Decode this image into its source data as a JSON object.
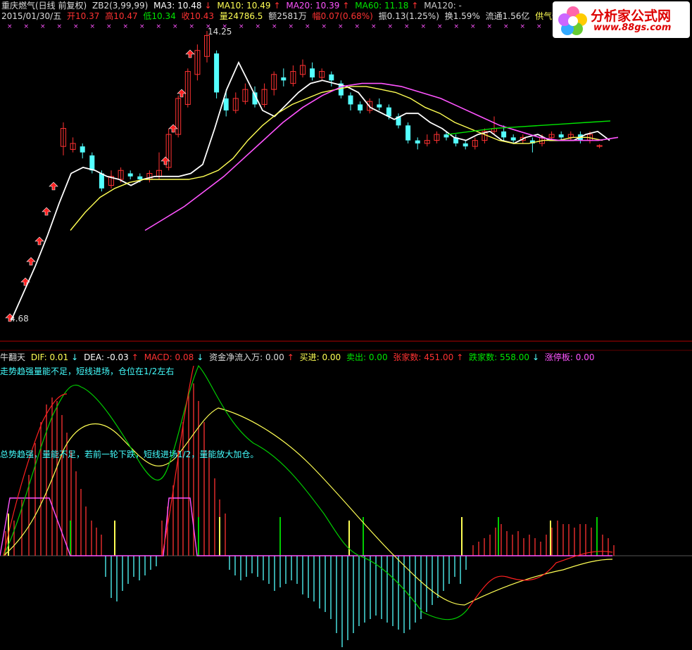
{
  "header": {
    "stock": "重庆燃气(日线 前复权)",
    "ind": "ZB2(3,99,99)",
    "ma3": "MA3: 10.48",
    "ma10": "MA10: 10.49",
    "ma20": "MA20: 10.39",
    "ma60": "MA60: 11.18",
    "ma120": "MA120: -",
    "date": "2015/01/30/五",
    "open": "开10.37",
    "high": "高10.47",
    "low": "低10.34",
    "close": "收10.43",
    "vol": "量24786.5",
    "amount": "额2581万",
    "pct": "幅0.07(0.68%)",
    "amp": "振0.13(1.25%)",
    "turn": "换1.59%",
    "float": "流通1.56亿",
    "tag": "供气供热",
    "high_label": "14.25",
    "low_label": "4.68"
  },
  "sub": {
    "name": "牛翻天",
    "dif": "DIF: 0.01",
    "dea": "DEA: -0.03",
    "macd": "MACD: 0.08",
    "fund": "资金净流入万: 0.00",
    "buy": "买进: 0.00",
    "sell": "卖出: 0.00",
    "up": "张家数: 451.00",
    "down": "跌家数: 558.00",
    "limit": "涨停板: 0.00",
    "note1": "走势趋强量能不足，短线进场，仓位在1/2左右",
    "note2": "总势趋强，量能不足，若前一轮下跌，短线进场1/2，量能放大加仓。"
  },
  "logo": {
    "title": "分析家公式网",
    "url": "www.88gs.com"
  },
  "colors": {
    "up": "#ff3232",
    "down": "#54ffff",
    "ma3": "#ffffff",
    "ma10": "#ffff54",
    "ma20": "#ff54ff",
    "ma60": "#00e600",
    "dea": "#ffff54",
    "dif_green": "#00cc00",
    "dif_red": "#ff2020"
  },
  "chart_data": [
    {
      "type": "candlestick",
      "title": "重庆燃气(日线 前复权)",
      "ylim": [
        4.68,
        14.25
      ],
      "annotations": [
        "14.25",
        "4.68"
      ],
      "series": [
        {
          "name": "MA3",
          "values": [
            5.0,
            5.6,
            6.4,
            7.3,
            8.3,
            9.2,
            9.4,
            9.3,
            9.1,
            8.9,
            8.6,
            8.5,
            8.6,
            8.8,
            8.8,
            8.9,
            8.9,
            9.0,
            9.7,
            10.9,
            11.9,
            12.8,
            12.2,
            11.7,
            11.5,
            11.6,
            12.0,
            12.4,
            12.6,
            12.6,
            12.5,
            12.5,
            12.4,
            12.3,
            11.8,
            11.6,
            11.3,
            11.4,
            11.6,
            11.4,
            11.3,
            11.0,
            10.6,
            10.4,
            10.3,
            10.6,
            10.6,
            10.4,
            10.3,
            10.3,
            10.4,
            10.5,
            10.5,
            10.5,
            10.6,
            10.6,
            10.5
          ]
        },
        {
          "name": "MA10",
          "values": [
            null,
            null,
            7.9,
            8.2,
            8.6,
            8.8,
            9.0,
            9.0,
            9.0,
            8.9,
            8.9,
            9.2,
            9.8,
            10.4,
            11.0,
            11.4,
            11.6,
            11.8,
            12.1,
            12.2,
            12.2,
            12.2,
            12.0,
            11.7,
            11.5,
            11.2,
            11.0,
            10.9,
            10.7,
            10.6,
            10.5,
            10.5,
            10.5,
            10.6,
            10.6
          ]
        },
        {
          "name": "MA20",
          "values": [
            8.1,
            8.5,
            9.0,
            9.5,
            10.1,
            10.7,
            11.3,
            11.8,
            12.2,
            12.4,
            12.4,
            12.4,
            12.3,
            12.1,
            11.9,
            11.6,
            11.3,
            11.0,
            10.7,
            10.6,
            10.5,
            10.5,
            10.4
          ]
        },
        {
          "name": "MA60",
          "values": [
            10.8,
            10.9,
            11.0,
            11.0,
            11.1,
            11.1,
            11.2
          ]
        }
      ]
    },
    {
      "type": "bar",
      "title": "牛翻天",
      "series": [
        {
          "name": "DIF",
          "values": [
            0.01
          ]
        },
        {
          "name": "DEA",
          "values": [
            -0.03
          ]
        },
        {
          "name": "MACD",
          "values": [
            0.08
          ]
        }
      ]
    }
  ]
}
